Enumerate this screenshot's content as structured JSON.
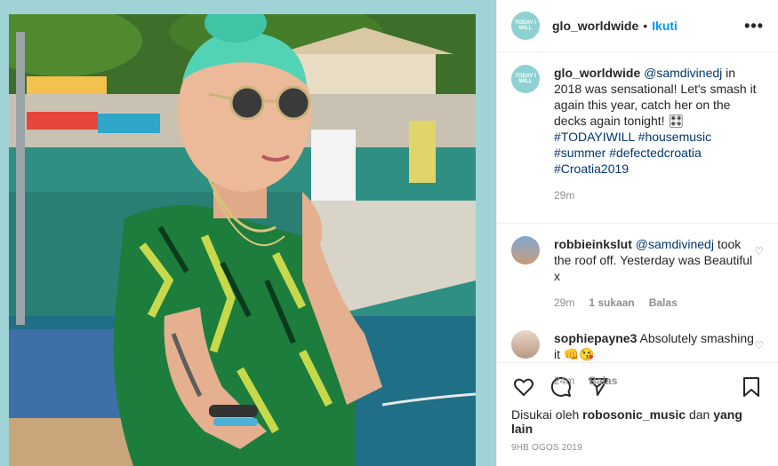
{
  "post": {
    "author": "glo_worldwide",
    "brand_avatar_text": "TODAY I WILL",
    "follow_label": "Ikuti",
    "more_label": "•••",
    "dot": "•"
  },
  "caption": {
    "author": "glo_worldwide",
    "mention": "@samdivinedj",
    "text_1": " in 2018 was sensational! Let's smash it again this year, catch her on the decks again tonight! ",
    "emoji": "🎛",
    "hashtags": "#TODAYIWILL #housemusic #summer #defectedcroatia #Croatia2019",
    "time": "29m"
  },
  "comments": [
    {
      "user": "robbieinkslut",
      "mention": "@samdivinedj",
      "text": " took the roof off. Yesterday was Beautiful x",
      "time": "29m",
      "likes": "1 sukaan",
      "reply": "Balas"
    },
    {
      "user": "sophiepayne3",
      "mention": "",
      "text": "Absolutely smashing it 👊😘",
      "time": "24m",
      "reply": "Balas"
    }
  ],
  "likes": {
    "prefix": "Disukai oleh ",
    "user": "robosonic_music",
    "middle": " dan ",
    "others": "yang lain"
  },
  "date": "9HB OGOS 2019",
  "colors": {
    "frame": "#9fd3d6",
    "link": "#00376b",
    "follow": "#0095f6",
    "muted": "#8e8e8e"
  },
  "icons": [
    "heart-icon",
    "comment-icon",
    "share-icon",
    "bookmark-icon",
    "more-icon",
    "heart-small-icon"
  ]
}
